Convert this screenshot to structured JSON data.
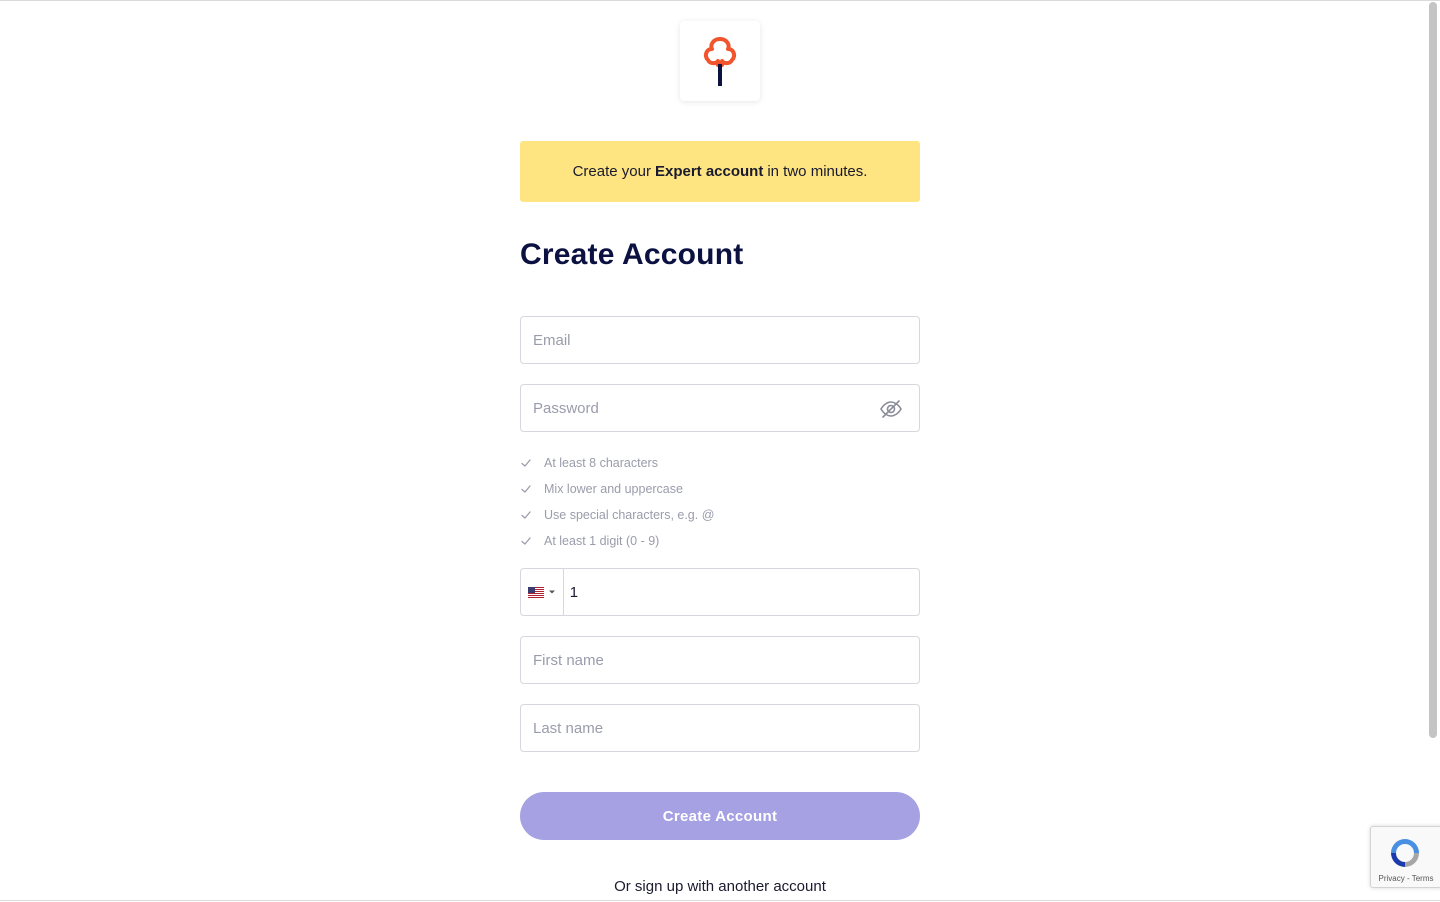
{
  "banner": {
    "prefix": "Create your",
    "bold": "Expert account",
    "suffix": "in two minutes."
  },
  "heading": "Create Account",
  "form": {
    "email_placeholder": "Email",
    "password_placeholder": "Password",
    "password_rules": [
      "At least 8 characters",
      "Mix lower and uppercase",
      "Use special characters, e.g. @",
      "At least 1 digit (0 - 9)"
    ],
    "phone_value": "1",
    "first_name_placeholder": "First name",
    "last_name_placeholder": "Last name"
  },
  "submit_label": "Create Account",
  "alt_signup": "Or sign up with another account",
  "recaptcha": {
    "privacy": "Privacy",
    "separator": " - ",
    "terms": "Terms"
  },
  "colors": {
    "banner_bg": "#fee582",
    "heading": "#0b1140",
    "button_disabled": "#a5a1e3",
    "logo_red": "#f2542d",
    "logo_navy": "#0b1140"
  },
  "icons": {
    "logo": "tree-logo-icon",
    "password_toggle": "eye-slash-icon",
    "rule_check": "check-icon",
    "phone_country": "us-flag-icon",
    "phone_dropdown": "caret-down-icon"
  }
}
